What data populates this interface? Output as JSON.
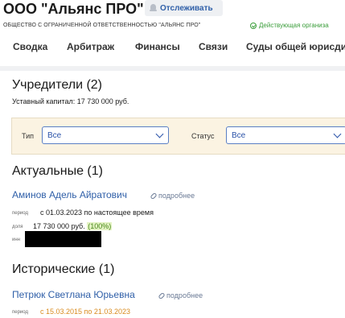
{
  "header": {
    "title": "ООО \"Альянс ПРО\"",
    "follow_label": "Отслеживать",
    "full_name": "ОБЩЕСТВО С ОГРАНИЧЕННОЙ ОТВЕТСТВЕННОСТЬЮ \"АЛЬЯНС ПРО\"",
    "status": "Действующая организа"
  },
  "tabs": [
    "Сводка",
    "Арбитраж",
    "Финансы",
    "Связи",
    "Суды общей юрисди"
  ],
  "founders": {
    "title": "Учредители (2)",
    "capital": "Уставный капитал: 17 730 000 руб."
  },
  "filters": {
    "type_label": "Тип",
    "type_value": "Все",
    "status_label": "Статус",
    "status_value": "Все"
  },
  "current": {
    "title": "Актуальные (1)",
    "person": "Аминов Адель Айратович",
    "more": "подробнее",
    "period_label": "период",
    "period_value": "с 01.03.2023 по настоящее время",
    "share_label": "доля",
    "share_value": "17 730 000 руб.",
    "share_pct": "(100%)",
    "inn_label": "инн"
  },
  "historical": {
    "title": "Исторические (1)",
    "person": "Петрюк Светлана Юрьевна",
    "more": "подробнее",
    "period_label": "период",
    "period_value": "с 15.03.2015 по 21.03.2023"
  },
  "colors": {
    "link": "#2f5fa8",
    "active_status": "#3a9d3a",
    "historic_period": "#d98b1e",
    "filter_bg": "#fbf3e2"
  }
}
